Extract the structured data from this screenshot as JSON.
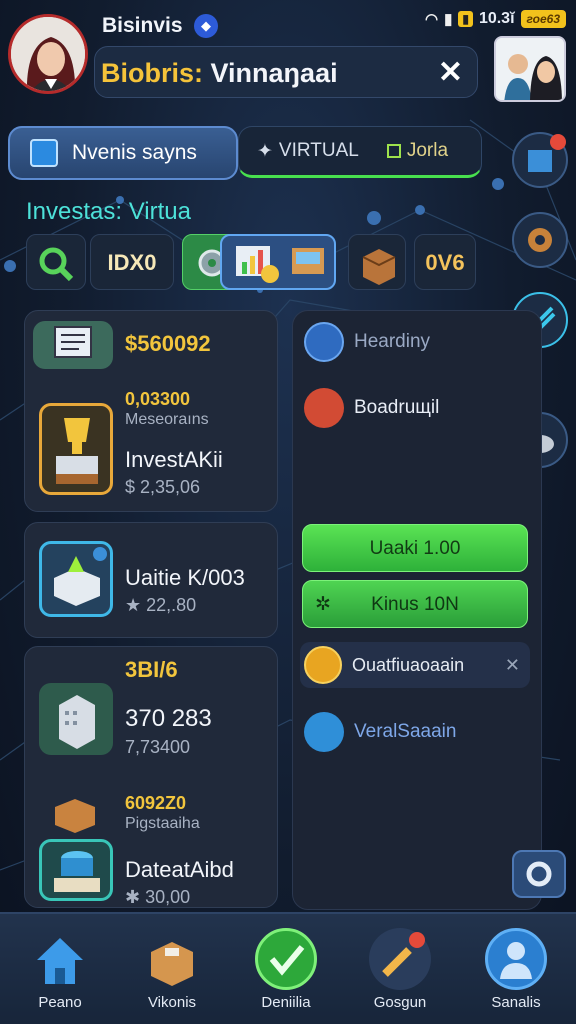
{
  "status_bar": {
    "app_name": "Bisinvis",
    "time": "10.3ĭ",
    "badge": "гое63"
  },
  "header": {
    "title_accent": "Biobris:",
    "title_main": "Vinnaŋaai",
    "close_label": "✕"
  },
  "tabs": {
    "active_label": "Nvenis sayns",
    "tab2_label": "VIRTUAL",
    "tab3_label": "Jorla"
  },
  "section_title": "Investas: Virtua",
  "filters": {
    "code_text": "IDX0",
    "percent_text": "0V6"
  },
  "cards": [
    {
      "value": "$560092"
    },
    {
      "amount": "0,03300",
      "sublabel": "Meseoraıns",
      "name": "InvestAKii",
      "price": "$ 2,35,06"
    },
    {
      "name": "Uaitie K/003",
      "price": "★ 22,.80"
    },
    {
      "code": "3BI/6",
      "value": "370 283",
      "sub": "7,73400"
    },
    {
      "amount": "6092Z0",
      "sublabel": "Pigstaaiha"
    },
    {
      "name": "DateatAibd",
      "price": "✱ 30,00"
    }
  ],
  "panel": {
    "row1": "Heardiny",
    "row2": "Boadruщil",
    "button1": "Uaaki 1.00",
    "button2": "Kinus 10N",
    "chip_label": "Ouatfiuaoaain",
    "chip_close": "✕",
    "row3": "VeralSaaain"
  },
  "nav": [
    {
      "label": "Peano"
    },
    {
      "label": "Vikonis"
    },
    {
      "label": "Deniilia"
    },
    {
      "label": "Gosgun"
    },
    {
      "label": "Sanalis"
    }
  ],
  "colors": {
    "accent": "#4de2d9",
    "green": "#3fcb46",
    "yellow": "#f2c53d",
    "panel": "#20293a"
  }
}
